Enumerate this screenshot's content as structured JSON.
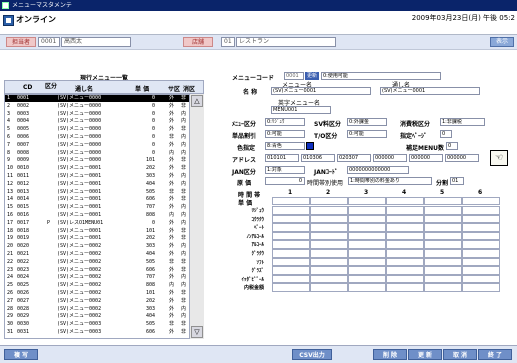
{
  "window": {
    "title": "メニューマスタメンテ"
  },
  "app": {
    "title": "オンライン",
    "datetime": "2009年03月23日(月) 午後 05:2"
  },
  "infobar": {
    "staff_label": "担当者",
    "staff_code": "0001",
    "staff_name": "高西太",
    "store_label": "店舗",
    "store_code": "01",
    "store_name": "レストラン",
    "display_button": "表示"
  },
  "list": {
    "title": "現行メニュー一覧",
    "headers": {
      "cd": "CD",
      "kubun": "区分",
      "name": "通し名",
      "price": "単 価",
      "sakubun": "サ区",
      "zeikubun": "消区"
    },
    "rows": [
      {
        "no": "1",
        "cd": "0001",
        "kubun": "",
        "name": "(SV)メニュー0000",
        "price": "0",
        "sa": "外",
        "ze": "非"
      },
      {
        "no": "2",
        "cd": "0002",
        "kubun": "",
        "name": "(SV)メニュー0000",
        "price": "0",
        "sa": "外",
        "ze": "非"
      },
      {
        "no": "3",
        "cd": "0003",
        "kubun": "",
        "name": "(SV)メニュー0000",
        "price": "0",
        "sa": "外",
        "ze": "内"
      },
      {
        "no": "4",
        "cd": "0004",
        "kubun": "",
        "name": "(SV)メニュー0000",
        "price": "0",
        "sa": "外",
        "ze": "内"
      },
      {
        "no": "5",
        "cd": "0005",
        "kubun": "",
        "name": "(SV)メニュー0000",
        "price": "0",
        "sa": "外",
        "ze": "非"
      },
      {
        "no": "6",
        "cd": "0006",
        "kubun": "",
        "name": "(SV)メニュー0000",
        "price": "0",
        "sa": "非",
        "ze": "内"
      },
      {
        "no": "7",
        "cd": "0007",
        "kubun": "",
        "name": "(SV)メニュー0000",
        "price": "0",
        "sa": "外",
        "ze": "内"
      },
      {
        "no": "8",
        "cd": "0008",
        "kubun": "",
        "name": "(SV)メニュー0000",
        "price": "0",
        "sa": "内",
        "ze": "内"
      },
      {
        "no": "9",
        "cd": "0009",
        "kubun": "",
        "name": "(SV)メニュー0000",
        "price": "101",
        "sa": "外",
        "ze": "非"
      },
      {
        "no": "10",
        "cd": "0010",
        "kubun": "",
        "name": "(SV)メニュー0001",
        "price": "202",
        "sa": "外",
        "ze": "非"
      },
      {
        "no": "11",
        "cd": "0011",
        "kubun": "",
        "name": "(SV)メニュー0001",
        "price": "303",
        "sa": "外",
        "ze": "内"
      },
      {
        "no": "12",
        "cd": "0012",
        "kubun": "",
        "name": "(SV)メニュー0001",
        "price": "404",
        "sw": "",
        "sa": "外",
        "ze": "内"
      },
      {
        "no": "13",
        "cd": "0013",
        "kubun": "",
        "name": "(SV)メニュー0001",
        "price": "505",
        "sa": "非",
        "ze": "非"
      },
      {
        "no": "14",
        "cd": "0014",
        "kubun": "",
        "name": "(SV)メニュー0001",
        "price": "606",
        "sa": "外",
        "ze": "非"
      },
      {
        "no": "15",
        "cd": "0015",
        "kubun": "",
        "name": "(SV)メニュー0001",
        "price": "707",
        "sa": "外",
        "ze": "内"
      },
      {
        "no": "16",
        "cd": "0016",
        "kubun": "",
        "name": "(SV)メニュー0001",
        "price": "808",
        "sa": "内",
        "ze": "内"
      },
      {
        "no": "17",
        "cd": "0017",
        "kubun": "P",
        "name": "(SV)レスO1MENU01",
        "price": "0",
        "sa": "外",
        "ze": "内"
      },
      {
        "no": "18",
        "cd": "0018",
        "kubun": "",
        "name": "(SV)メニュー0001",
        "price": "101",
        "sa": "外",
        "ze": "非"
      },
      {
        "no": "19",
        "cd": "0019",
        "kubun": "",
        "name": "(SV)メニュー0001",
        "price": "202",
        "sa": "外",
        "ze": "非"
      },
      {
        "no": "20",
        "cd": "0020",
        "kubun": "",
        "name": "(SV)メニュー0002",
        "price": "303",
        "sa": "外",
        "ze": "内"
      },
      {
        "no": "21",
        "cd": "0021",
        "kubun": "",
        "name": "(SV)メニュー0002",
        "price": "404",
        "sa": "外",
        "ze": "内"
      },
      {
        "no": "22",
        "cd": "0022",
        "kubun": "",
        "name": "(SV)メニュー0002",
        "price": "505",
        "sa": "非",
        "ze": "非"
      },
      {
        "no": "23",
        "cd": "0023",
        "kubun": "",
        "name": "(SV)メニュー0002",
        "price": "606",
        "sa": "外",
        "ze": "非"
      },
      {
        "no": "24",
        "cd": "0024",
        "kubun": "",
        "name": "(SV)メニュー0002",
        "price": "707",
        "sa": "外",
        "ze": "内"
      },
      {
        "no": "25",
        "cd": "0025",
        "kubun": "",
        "name": "(SV)メニュー0002",
        "price": "808",
        "sa": "内",
        "ze": "内"
      },
      {
        "no": "26",
        "cd": "0026",
        "kubun": "",
        "name": "(SV)メニュー0002",
        "price": "101",
        "sa": "外",
        "ze": "非"
      },
      {
        "no": "27",
        "cd": "0027",
        "kubun": "",
        "name": "(SV)メニュー0002",
        "price": "202",
        "sa": "外",
        "ze": "非"
      },
      {
        "no": "28",
        "cd": "0028",
        "kubun": "",
        "name": "(SV)メニュー0002",
        "price": "303",
        "sa": "外",
        "ze": "内"
      },
      {
        "no": "29",
        "cd": "0029",
        "kubun": "",
        "name": "(SV)メニュー0002",
        "price": "404",
        "sa": "外",
        "ze": "内"
      },
      {
        "no": "30",
        "cd": "0030",
        "kubun": "",
        "name": "(SV)メニュー0003",
        "price": "505",
        "sa": "非",
        "ze": "非"
      },
      {
        "no": "31",
        "cd": "0031",
        "kubun": "",
        "name": "(SV)メニュー0003",
        "price": "606",
        "sa": "外",
        "ze": "非"
      }
    ]
  },
  "form": {
    "menu_code_label": "メニューコード",
    "menu_code": "0001",
    "mode_badge": "更新",
    "status_select": "0:使用可能",
    "name_label": "名 称",
    "menu_name_caption": "メニュー名",
    "menu_name": "(SV)メニュー0001",
    "short_name_caption": "通し名",
    "short_name": "(SV)メニュー0001",
    "english_caption": "英字メニュー名",
    "english_name": "MENU001",
    "menu_kubun_label": "ﾒﾆｭｰ区分",
    "menu_kubun": "0:ﾘｼﾞｭｳ",
    "sv_kubun_label": "SV料区分",
    "sv_kubun": "0:外課金",
    "tax_kubun_label": "消費税区分",
    "tax_kubun": "1:非課税",
    "discount_label": "単品割引",
    "discount": "0:可能",
    "to_kubun_label": "T/O区分",
    "to_kubun": "0:可能",
    "page_label": "指定ﾍﾟｰｼﾞ",
    "page_value": "0",
    "color_label": "色指定",
    "color_value": "8:青色",
    "supplement_label": "補足MENU数",
    "supplement_value": "0",
    "address_label": "アドレス",
    "addresses": [
      "010101",
      "010306",
      "020307",
      "000000",
      "000000",
      "000000"
    ],
    "jan_kubun_label": "JAN区分",
    "jan_kubun": "1:対象",
    "jan_code_label": "JANｺｰﾄﾞ",
    "jan_code": "0000000000000",
    "cost_label": "原 価",
    "cost_value": "0",
    "time_price_label": "時間帯別使用",
    "time_price_select": "1:時間帯別の料金あり",
    "minute_label": "分割",
    "minute_value": "01",
    "grid_time_label": "時 間 帯",
    "grid_price_label": "単 価",
    "grid_columns": [
      "1",
      "2",
      "3",
      "4",
      "5",
      "6"
    ],
    "grid_rows": [
      "ﾘｼﾞｭｳ",
      "ｺｳﾗｸｳ",
      "ﾍﾟｰﾄ",
      "ﾉﾝｱﾙｺｰﾙ",
      "ｱﾙｺｰﾙ",
      "ｸﾞﾗｸｳ",
      "ｿﾌﾄ",
      "ｸﾞﾗｽﾞ",
      "ｲｯﾀﾞﾋﾞﾟｰﾙ",
      "内税金額"
    ]
  },
  "footer": {
    "copy": "複 写",
    "csv": "CSV出力",
    "delete": "削 除",
    "update": "更 新",
    "cancel": "取 消",
    "exit": "終 了"
  },
  "colors": {
    "titlebar": "#0a246a",
    "accent_button": "#6f8fc8",
    "list_header": "#dfe6f4"
  }
}
